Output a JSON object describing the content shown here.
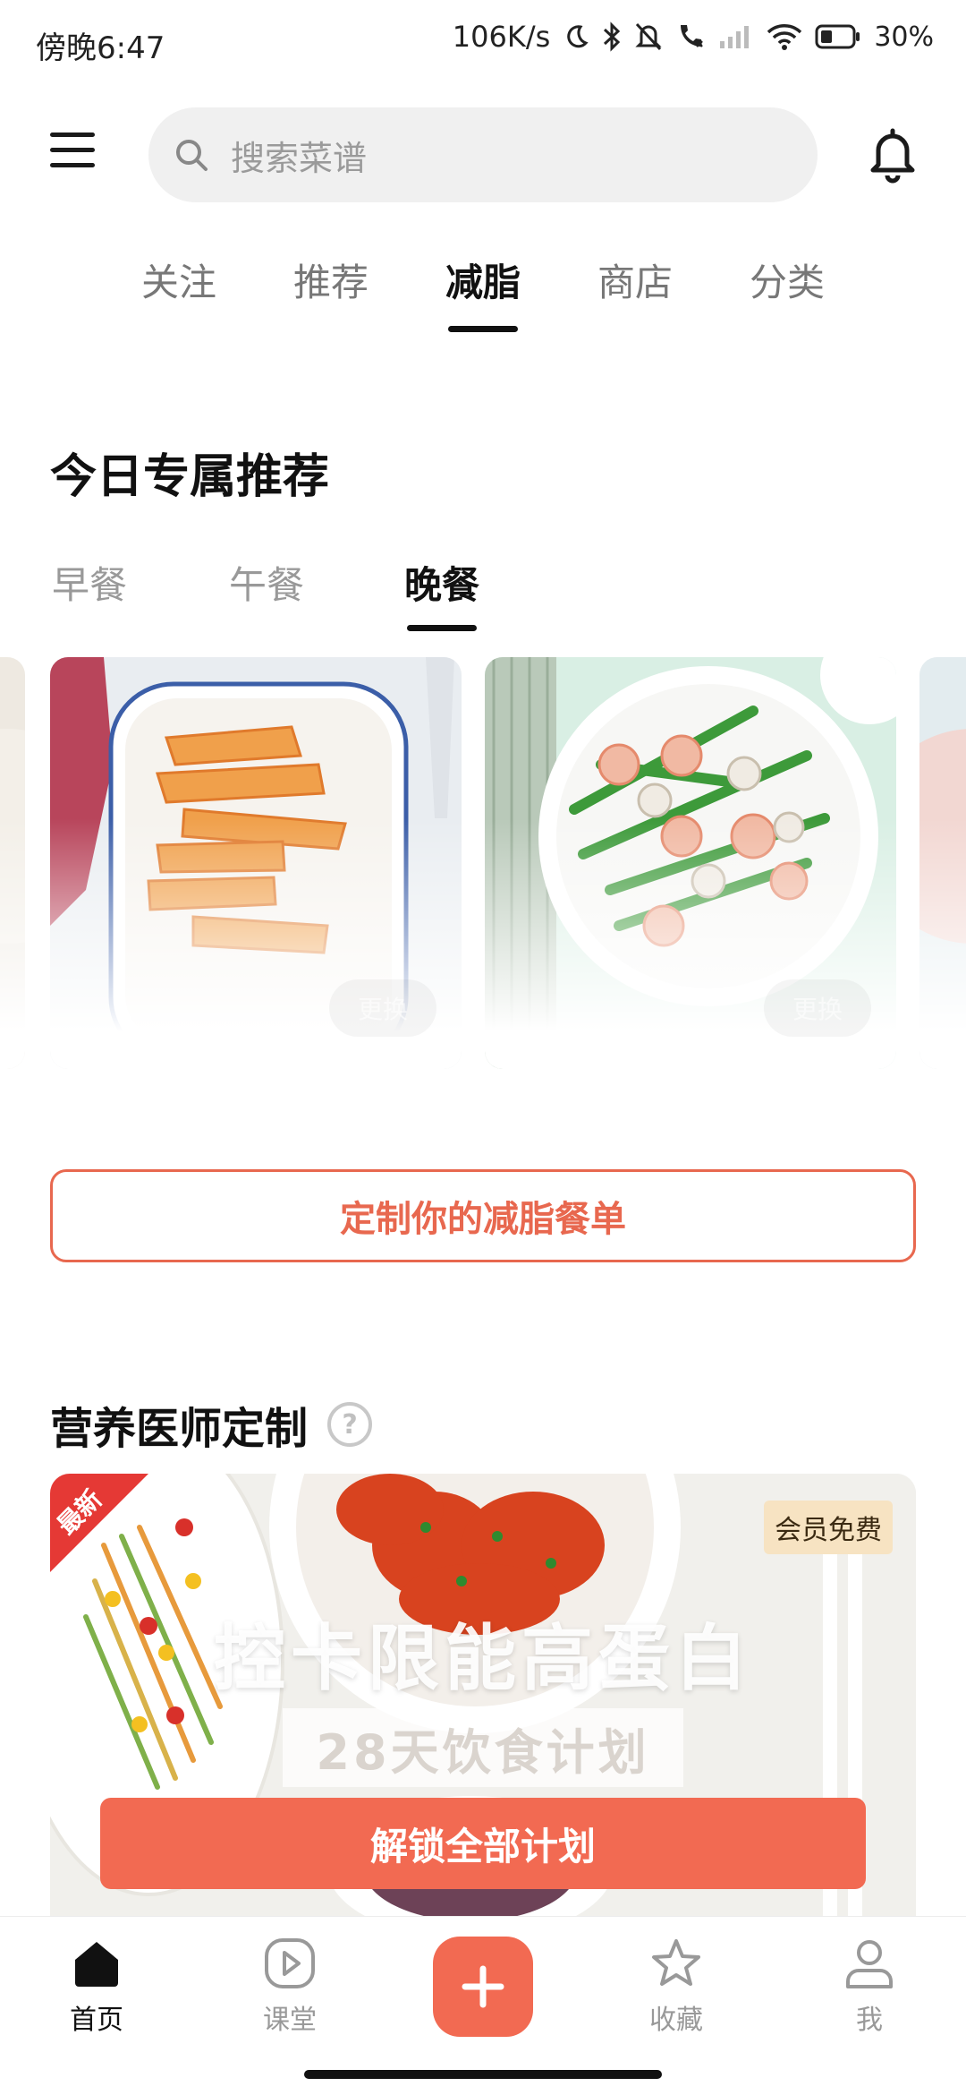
{
  "status": {
    "time": "傍晚6:47",
    "speed": "106K/s",
    "battery": "30%"
  },
  "search": {
    "placeholder": "搜索菜谱"
  },
  "main_tabs": [
    {
      "label": "关注",
      "active": false
    },
    {
      "label": "推荐",
      "active": false
    },
    {
      "label": "减脂",
      "active": true
    },
    {
      "label": "商店",
      "active": false
    },
    {
      "label": "分类",
      "active": false
    }
  ],
  "recommend": {
    "title": "今日专属推荐",
    "meal_tabs": [
      {
        "label": "早餐",
        "active": false
      },
      {
        "label": "午餐",
        "active": false
      },
      {
        "label": "晚餐",
        "active": true
      }
    ],
    "cards": [
      {
        "dish": "sweet-potato-wedges",
        "swap_label": "更换"
      },
      {
        "dish": "shrimp-asparagus-mushroom",
        "swap_label": "更换"
      }
    ]
  },
  "customize": {
    "label": "定制你的减脂餐单"
  },
  "nutrition": {
    "title": "营养医师定制",
    "banner": {
      "ribbon": "最新",
      "badge": "会员免费",
      "headline": "控卡限能高蛋白",
      "subheadline": "28天饮食计划",
      "unlock_label": "解锁全部计划"
    }
  },
  "bottom_nav": [
    {
      "label": "首页",
      "icon": "home-icon",
      "active": true
    },
    {
      "label": "课堂",
      "icon": "play-icon",
      "active": false
    },
    {
      "label": "",
      "icon": "plus-icon",
      "active": false
    },
    {
      "label": "收藏",
      "icon": "star-icon",
      "active": false
    },
    {
      "label": "我",
      "icon": "user-icon",
      "active": false
    }
  ],
  "colors": {
    "accent": "#f26a52",
    "outline_accent": "#e8684f",
    "badge_bg": "#f7e3c2",
    "ribbon": "#e53935"
  }
}
